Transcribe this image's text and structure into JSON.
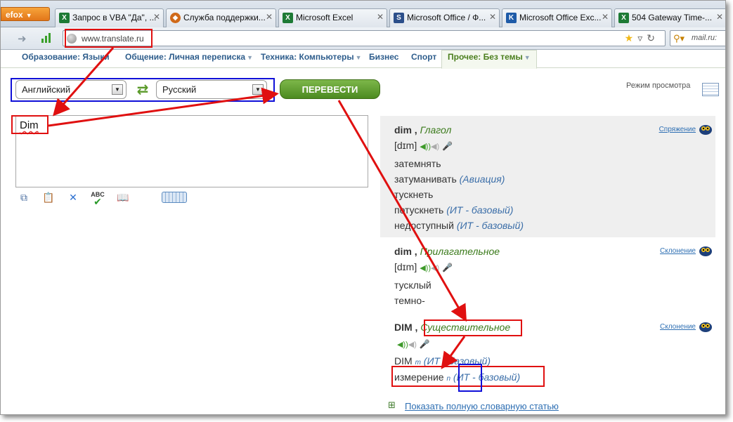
{
  "browser": {
    "menu_label": "efox",
    "tabs": [
      {
        "title": "Запрос в VBA \"Да\", ...",
        "icon_color": "#1d7a35",
        "icon_glyph": "X"
      },
      {
        "title": "Служба поддержки...",
        "icon_color": "#d06a1a",
        "icon_glyph": "◆"
      },
      {
        "title": "Microsoft Excel",
        "icon_color": "#1d7a35",
        "icon_glyph": "X"
      },
      {
        "title": "Microsoft Office / Ф...",
        "icon_color": "#2c4f8a",
        "icon_glyph": "S"
      },
      {
        "title": "Microsoft Office Exc...",
        "icon_color": "#1e5ba8",
        "icon_glyph": "K"
      },
      {
        "title": "504 Gateway Time-...",
        "icon_color": "#1d7a35",
        "icon_glyph": "X"
      }
    ],
    "url": "www.translate.ru",
    "search_placeholder": "mail.ru:"
  },
  "site_menu": {
    "items": [
      {
        "label": "Образование: Языки",
        "has_dropdown": false
      },
      {
        "label": "Общение: Личная переписка",
        "has_dropdown": true
      },
      {
        "label": "Техника: Компьютеры",
        "has_dropdown": true
      },
      {
        "label": "Бизнес",
        "has_dropdown": false
      },
      {
        "label": "Спорт",
        "has_dropdown": false
      },
      {
        "label": "Прочее: Без темы",
        "has_dropdown": true,
        "active": true
      }
    ]
  },
  "translator": {
    "source_lang": "Английский",
    "target_lang": "Русский",
    "translate_button": "ПЕРЕВЕСТИ",
    "view_mode_label": "Режим просмотра",
    "source_text": "Dim"
  },
  "results": [
    {
      "word": "dim",
      "part_of_speech": "Глагол",
      "link": "Спряжение",
      "transcription": "[dɪm]",
      "translations": [
        {
          "text": "затемнять",
          "note": ""
        },
        {
          "text": "затуманивать",
          "note": "(Авиация)"
        },
        {
          "text": "тускнеть",
          "note": ""
        },
        {
          "text": "потускнеть",
          "note": "(ИТ - базовый)"
        },
        {
          "text": "недоступный",
          "note": "(ИТ - базовый)"
        }
      ]
    },
    {
      "word": "dim",
      "part_of_speech": "Прилагательное",
      "link": "Склонение",
      "transcription": "[dɪm]",
      "translations": [
        {
          "text": "тусклый",
          "note": ""
        },
        {
          "text": "темно-",
          "note": ""
        }
      ]
    },
    {
      "word": "DIM",
      "part_of_speech": "Существительное",
      "link": "Склонение",
      "transcription": "",
      "translations": [
        {
          "text": "DIM",
          "gram": "m",
          "note": "(ИТ - базовый)"
        },
        {
          "text": "измерение",
          "gram": "n",
          "note": "(ИТ - базовый)"
        }
      ]
    }
  ],
  "full_article_link": "Показать полную словарную статью",
  "colors": {
    "annotation_red": "#e01010",
    "annotation_blue": "#1010d8",
    "accent_green": "#4c8a20"
  }
}
